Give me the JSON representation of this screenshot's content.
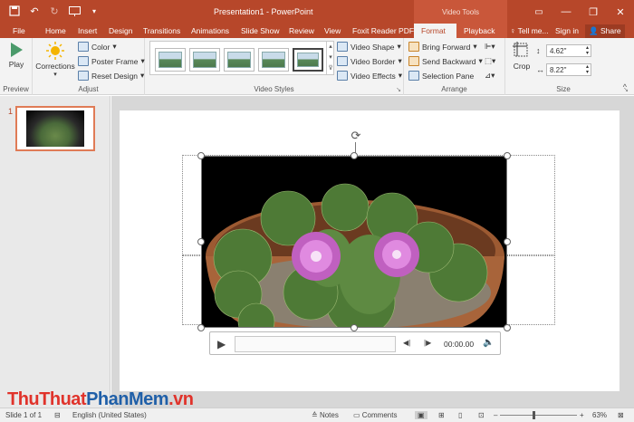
{
  "window": {
    "title": "Presentation1 - PowerPoint",
    "contextual_tab_group": "Video Tools",
    "controls": [
      "minimize",
      "restore",
      "close"
    ]
  },
  "qat": {
    "items": [
      "save-icon",
      "undo-icon",
      "redo-icon",
      "start-from-beginning-icon",
      "customize-icon"
    ]
  },
  "tabs": [
    {
      "label": "File"
    },
    {
      "label": "Home"
    },
    {
      "label": "Insert"
    },
    {
      "label": "Design"
    },
    {
      "label": "Transitions"
    },
    {
      "label": "Animations"
    },
    {
      "label": "Slide Show"
    },
    {
      "label": "Review"
    },
    {
      "label": "View"
    },
    {
      "label": "Foxit Reader PDF"
    },
    {
      "label": "Format",
      "active": true
    },
    {
      "label": "Playback"
    }
  ],
  "tell_me": "Tell me...",
  "sign_in": "Sign in",
  "share": "Share",
  "ribbon": {
    "preview": {
      "label": "Preview",
      "play": "Play"
    },
    "adjust": {
      "label": "Adjust",
      "corrections": "Corrections",
      "color": "Color",
      "poster_frame": "Poster Frame",
      "reset_design": "Reset Design"
    },
    "video_styles": {
      "label": "Video Styles",
      "video_shape": "Video Shape",
      "video_border": "Video Border",
      "video_effects": "Video Effects"
    },
    "arrange": {
      "label": "Arrange",
      "bring_forward": "Bring Forward",
      "send_backward": "Send Backward",
      "selection_pane": "Selection Pane"
    },
    "size": {
      "label": "Size",
      "crop": "Crop",
      "height": "4.62\"",
      "width": "8.22\""
    }
  },
  "slides": [
    {
      "number": "1"
    }
  ],
  "player": {
    "time": "00:00.00"
  },
  "watermark": {
    "part1": "ThuThuat",
    "part2": "PhanMem",
    "part3": ".vn"
  },
  "status": {
    "slide": "Slide 1 of 1",
    "language": "English (United States)",
    "notes": "Notes",
    "comments": "Comments",
    "zoom": "63%",
    "zoom_fraction": 0.63
  }
}
